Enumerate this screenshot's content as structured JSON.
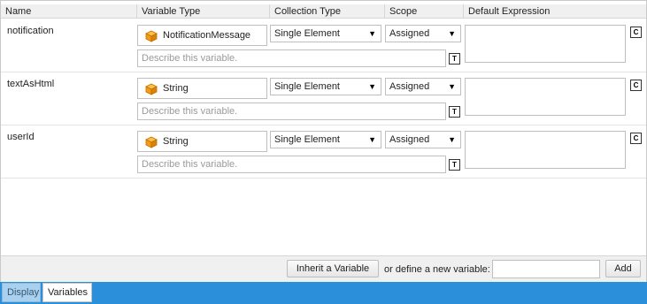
{
  "columns": {
    "name": "Name",
    "variable_type": "Variable Type",
    "collection_type": "Collection Type",
    "scope": "Scope",
    "default_expression": "Default Expression"
  },
  "rows": [
    {
      "name": "notification",
      "type": "NotificationMessage",
      "collection": "Single Element",
      "scope": "Assigned",
      "description_placeholder": "Describe this variable.",
      "description_button": "T",
      "expression_button": "C"
    },
    {
      "name": "textAsHtml",
      "type": "String",
      "collection": "Single Element",
      "scope": "Assigned",
      "description_placeholder": "Describe this variable.",
      "description_button": "T",
      "expression_button": "C"
    },
    {
      "name": "userId",
      "type": "String",
      "collection": "Single Element",
      "scope": "Assigned",
      "description_placeholder": "Describe this variable.",
      "description_button": "T",
      "expression_button": "C"
    }
  ],
  "footer": {
    "inherit_button": "Inherit a Variable",
    "define_label": "or define a new variable:",
    "new_variable_value": "",
    "add_button": "Add"
  },
  "tabs": [
    {
      "label": "Display",
      "active": false
    },
    {
      "label": "Variables",
      "active": true
    }
  ],
  "icons": {
    "type_icon": "orange-cube-icon",
    "dropdown_icon": "dropdown-arrow-icon"
  },
  "colors": {
    "tab_bar": "#2b90d9",
    "cube": "#f39c12"
  }
}
